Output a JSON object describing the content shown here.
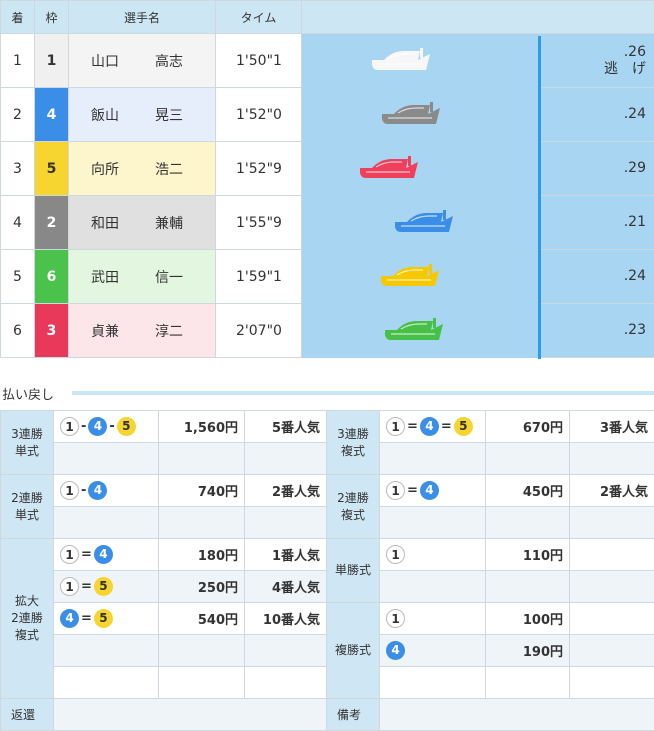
{
  "race_table": {
    "headers": [
      "着",
      "枠",
      "選手名",
      "タイム"
    ],
    "rows": [
      {
        "place": "1",
        "frame": "1",
        "last": "山口",
        "first": "高志",
        "time": "1'50\"1",
        "st": ".26",
        "note": "逃　げ",
        "frame_bg": "#f0f0f0",
        "frame_fg": "#333333",
        "name_bg": "#f4f4f4",
        "boat_color": "#f7f7f7"
      },
      {
        "place": "2",
        "frame": "4",
        "last": "飯山",
        "first": "晃三",
        "time": "1'52\"0",
        "st": ".24",
        "note": "",
        "frame_bg": "#3a8ee8",
        "frame_fg": "#ffffff",
        "name_bg": "#e6eefb",
        "boat_color": "#8a8a8a"
      },
      {
        "place": "3",
        "frame": "5",
        "last": "向所",
        "first": "浩二",
        "time": "1'52\"9",
        "st": ".29",
        "note": "",
        "frame_bg": "#f6d531",
        "frame_fg": "#333333",
        "name_bg": "#fdf6cd",
        "boat_color": "#ef3f5b"
      },
      {
        "place": "4",
        "frame": "2",
        "last": "和田",
        "first": "兼輔",
        "time": "1'55\"9",
        "st": ".21",
        "note": "",
        "frame_bg": "#888888",
        "frame_fg": "#ffffff",
        "name_bg": "#e0e0e0",
        "boat_color": "#3a8ee8"
      },
      {
        "place": "5",
        "frame": "6",
        "last": "武田",
        "first": "信一",
        "time": "1'59\"1",
        "st": ".24",
        "note": "",
        "frame_bg": "#4bc24b",
        "frame_fg": "#ffffff",
        "name_bg": "#e3f6df",
        "boat_color": "#f6c800"
      },
      {
        "place": "6",
        "frame": "3",
        "last": "貞兼",
        "first": "淳二",
        "time": "2'07\"0",
        "st": ".23",
        "note": "",
        "frame_bg": "#e8395b",
        "frame_fg": "#ffffff",
        "name_bg": "#fde6ea",
        "boat_color": "#46c046"
      }
    ]
  },
  "payout": {
    "section_title": "払い戻し",
    "sanrentan": {
      "label1": "3連勝",
      "label2": "単式",
      "amount": "1,560円",
      "pop": "5番人気"
    },
    "sanrenpuku": {
      "label1": "3連勝",
      "label2": "複式",
      "amount": "670円",
      "pop": "3番人気"
    },
    "nirentan": {
      "label1": "2連勝",
      "label2": "単式",
      "amount": "740円",
      "pop": "2番人気"
    },
    "nirenpuku": {
      "label1": "2連勝",
      "label2": "複式",
      "amount": "450円",
      "pop": "2番人気"
    },
    "kakudai": {
      "label1": "拡大",
      "label2": "2連勝",
      "label3": "複式",
      "rows": [
        {
          "amount": "180円",
          "pop": "1番人気"
        },
        {
          "amount": "250円",
          "pop": "4番人気"
        },
        {
          "amount": "540円",
          "pop": "10番人気"
        }
      ]
    },
    "tansho": {
      "label": "単勝式",
      "amount": "110円"
    },
    "fukusho": {
      "label": "複勝式",
      "rows": [
        {
          "amount": "100円"
        },
        {
          "amount": "190円"
        }
      ]
    },
    "henkan": "返還",
    "biko": "備考",
    "sep_dash": "-",
    "sep_eq": "=",
    "n1": "1",
    "n4": "4",
    "n5": "5"
  }
}
